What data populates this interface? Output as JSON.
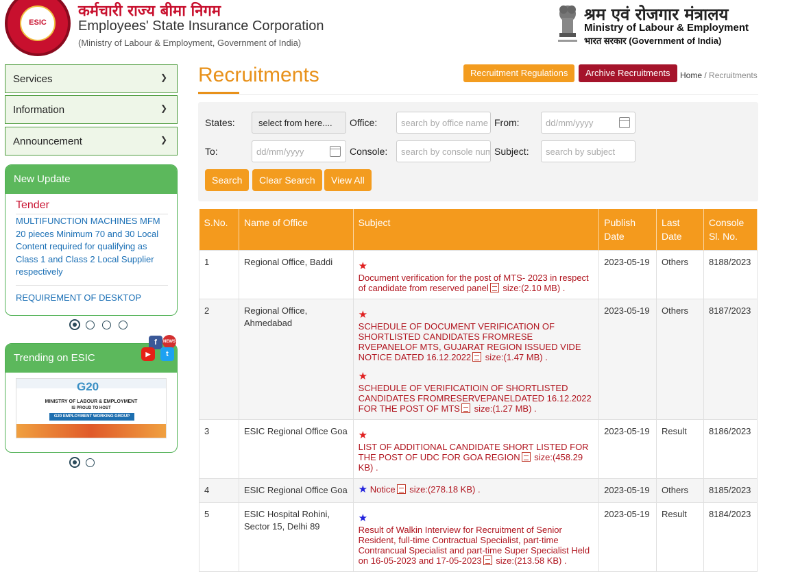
{
  "header": {
    "logo_text": "ESIC",
    "hindi_name": "कर्मचारी राज्य बीमा निगम",
    "english_name": "Employees' State Insurance Corporation",
    "sub_name": "(Ministry of Labour & Employment, Government of India)",
    "ministry_hindi": "श्रम एवं रोजगार मंत्रालय",
    "ministry_english": "Ministry of Labour & Employment",
    "ministry_gov": "भारत सरकार (Government of India)"
  },
  "sidebar": {
    "menu": [
      {
        "label": "Services"
      },
      {
        "label": "Information"
      },
      {
        "label": "Announcement"
      }
    ],
    "new_update": {
      "heading": "New Update",
      "category": "Tender",
      "items": [
        "MULTIFUNCTION MACHINES MFM 20 pieces Minimum 70 and 30 Local Content required for qualifying as Class 1 and Class 2 Local Supplier respectively",
        "REQUIREMENT OF DESKTOP"
      ]
    },
    "trending": {
      "heading": "Trending on ESIC",
      "banner_title": "MINISTRY OF LABOUR & EMPLOYMENT",
      "banner_sub": "IS PROUD TO HOST",
      "banner_tag": "G20 EMPLOYMENT WORKING GROUP",
      "banner_logo": "G20"
    }
  },
  "main": {
    "title": "Recruitments",
    "btn_regulations": "Recruitment Regulations",
    "btn_archive": "Archive Recruitments",
    "breadcrumb_home": "Home",
    "breadcrumb_sep": "/",
    "breadcrumb_current": "Recruitments"
  },
  "filter": {
    "states_label": "States:",
    "states_value": "select from here....",
    "office_label": "Office:",
    "office_placeholder": "search by office name",
    "from_label": "From:",
    "from_placeholder": "dd/mm/yyyy",
    "to_label": "To:",
    "to_placeholder": "dd/mm/yyyy",
    "console_label": "Console:",
    "console_placeholder": "search by console number",
    "subject_label": "Subject:",
    "subject_placeholder": "search by subject",
    "search_btn": "Search",
    "clear_btn": "Clear Search",
    "viewall_btn": "View All"
  },
  "table": {
    "headers": [
      "S.No.",
      "Name of Office",
      "Subject",
      "Publish Date",
      "Last Date",
      "Console Sl. No."
    ],
    "rows": [
      {
        "sno": "1",
        "office": "Regional Office, Baddi",
        "entries": [
          {
            "text": "Document verification for the post of MTS- 2023 in respect of candidate from reserved panel",
            "size": "size:(2.10 MB) ."
          }
        ],
        "publish": "2023-05-19",
        "last": "Others",
        "console": "8188/2023"
      },
      {
        "sno": "2",
        "office": "Regional Office, Ahmedabad",
        "entries": [
          {
            "text": "SCHEDULE OF DOCUMENT VERIFICATION OF SHORTLISTED CANDIDATES FROMRESE RVEPANELOF MTS, GUJARAT REGION ISSUED VIDE NOTICE DATED 16.12.2022",
            "size": "size:(1.47 MB) ."
          },
          {
            "text": "SCHEDULE OF VERIFICATIOIN OF SHORTLISTED CANDIDATES FROMRESERVEPANELDATED 16.12.2022 FOR THE POST OF MTS",
            "size": "size:(1.27 MB) ."
          }
        ],
        "publish": "2023-05-19",
        "last": "Others",
        "console": "8187/2023"
      },
      {
        "sno": "3",
        "office": "ESIC Regional Office Goa",
        "entries": [
          {
            "text": "LIST OF ADDITIONAL CANDIDATE SHORT LISTED FOR THE POST OF UDC FOR GOA REGION",
            "size": "size:(458.29 KB) ."
          }
        ],
        "publish": "2023-05-19",
        "last": "Result",
        "console": "8186/2023"
      },
      {
        "sno": "4",
        "office": "ESIC Regional Office Goa",
        "entries": [
          {
            "text": "Notice",
            "size": "size:(278.18 KB) ."
          }
        ],
        "publish": "2023-05-19",
        "last": "Others",
        "console": "8185/2023"
      },
      {
        "sno": "5",
        "office": "ESIC Hospital Rohini, Sector 15, Delhi 89",
        "entries": [
          {
            "text": "Result of Walkin Interview for Recruitment of Senior Resident, full-time Contractual Specialist, part-time Contrancual Specialist and part-time Super Specialist Held on 16-05-2023 and 17-05-2023",
            "size": "size:(213.58 KB) ."
          }
        ],
        "publish": "2023-05-19",
        "last": "Result",
        "console": "8184/2023"
      }
    ]
  },
  "colors": {
    "accent": "#f49a1d",
    "brand_red": "#c8102e",
    "sidebar_green": "#5cb85c",
    "link_red": "#b0141e"
  },
  "icons": {
    "menu_chevron": "chevron-down-icon",
    "star_new": "star-icon",
    "pdf": "pdf-icon",
    "calendar": "calendar-icon",
    "social": [
      "facebook-icon",
      "news-icon",
      "youtube-icon",
      "twitter-icon"
    ]
  }
}
